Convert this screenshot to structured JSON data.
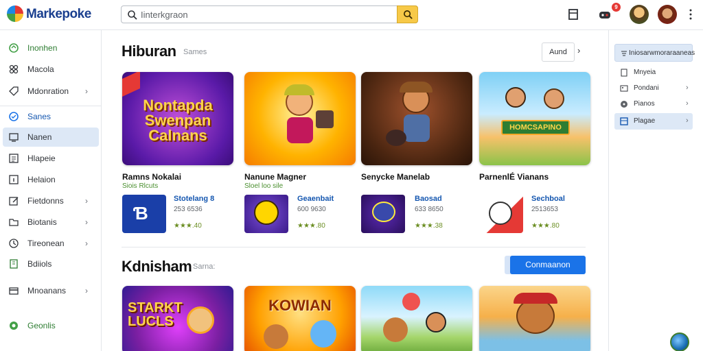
{
  "app": {
    "brand": "Markepoke"
  },
  "search": {
    "placeholder": "Iinterkgraon"
  },
  "header": {
    "notification_count": "9"
  },
  "sidebar": {
    "items": [
      {
        "label": "Inonhen",
        "icon": "home-icon",
        "chevron": false
      },
      {
        "label": "Macola",
        "icon": "apps-icon",
        "chevron": false
      },
      {
        "label": "Mdonration",
        "icon": "tag-icon",
        "chevron": true
      },
      {
        "label": "Sanes",
        "icon": "games-icon",
        "chevron": false
      },
      {
        "label": "Nanen",
        "icon": "monitor-icon",
        "chevron": false
      },
      {
        "label": "Hlapeie",
        "icon": "list-icon",
        "chevron": false
      },
      {
        "label": "Helaion",
        "icon": "info-icon",
        "chevron": false
      },
      {
        "label": "Fietdonns",
        "icon": "edit-icon",
        "chevron": true
      },
      {
        "label": "Biotanis",
        "icon": "folder-icon",
        "chevron": true
      },
      {
        "label": "Tireonean",
        "icon": "clock-icon",
        "chevron": true
      },
      {
        "label": "Bdiiols",
        "icon": "book-icon",
        "chevron": false
      },
      {
        "label": "Mnoanans",
        "icon": "card-icon",
        "chevron": true
      },
      {
        "label": "Geonlis",
        "icon": "settings-icon",
        "chevron": false
      }
    ]
  },
  "section1": {
    "title": "Hiburan",
    "subtitle": "Sames",
    "see_all": "Aund",
    "tiles": [
      {
        "name": "Ramns Nokalai",
        "tag": "Siois Rlcuts",
        "art": "Nontapda Swenpan Calnans"
      },
      {
        "name": "Nanune Magner",
        "tag": "Sloel loo sile",
        "art": ""
      },
      {
        "name": "Senycke Manelab",
        "tag": "",
        "art": ""
      },
      {
        "name": "ParnenlÉ Vianans",
        "tag": "",
        "art": "HOMCSAPINO"
      }
    ],
    "apps": [
      {
        "name": "Stotelang 8",
        "meta": "253 6536",
        "rating": "★★★.40"
      },
      {
        "name": "Geaenbait",
        "meta": "600 9630",
        "rating": "★★★.80"
      },
      {
        "name": "Baosad",
        "meta": "633 8650",
        "rating": "★★★.38"
      },
      {
        "name": "Sechboal",
        "meta": "2513653",
        "rating": "★★★.80"
      }
    ]
  },
  "section2": {
    "title": "Kdnisham",
    "subtitle": "Sarna:",
    "button": "Conmaanon",
    "tiles": [
      {
        "art": "STARKT LUCLS"
      },
      {
        "art": "KOWIAN"
      },
      {
        "art": ""
      },
      {
        "art": ""
      }
    ]
  },
  "right_panel": {
    "header": "Iniosarwmoraraaneas",
    "items": [
      {
        "label": "Mnyeia",
        "icon": "document-icon",
        "chevron": false
      },
      {
        "label": "Pondani",
        "icon": "image-icon",
        "chevron": true
      },
      {
        "label": "Pianos",
        "icon": "disc-icon",
        "chevron": true
      },
      {
        "label": "Plagae",
        "icon": "grid-icon",
        "chevron": true
      }
    ]
  }
}
